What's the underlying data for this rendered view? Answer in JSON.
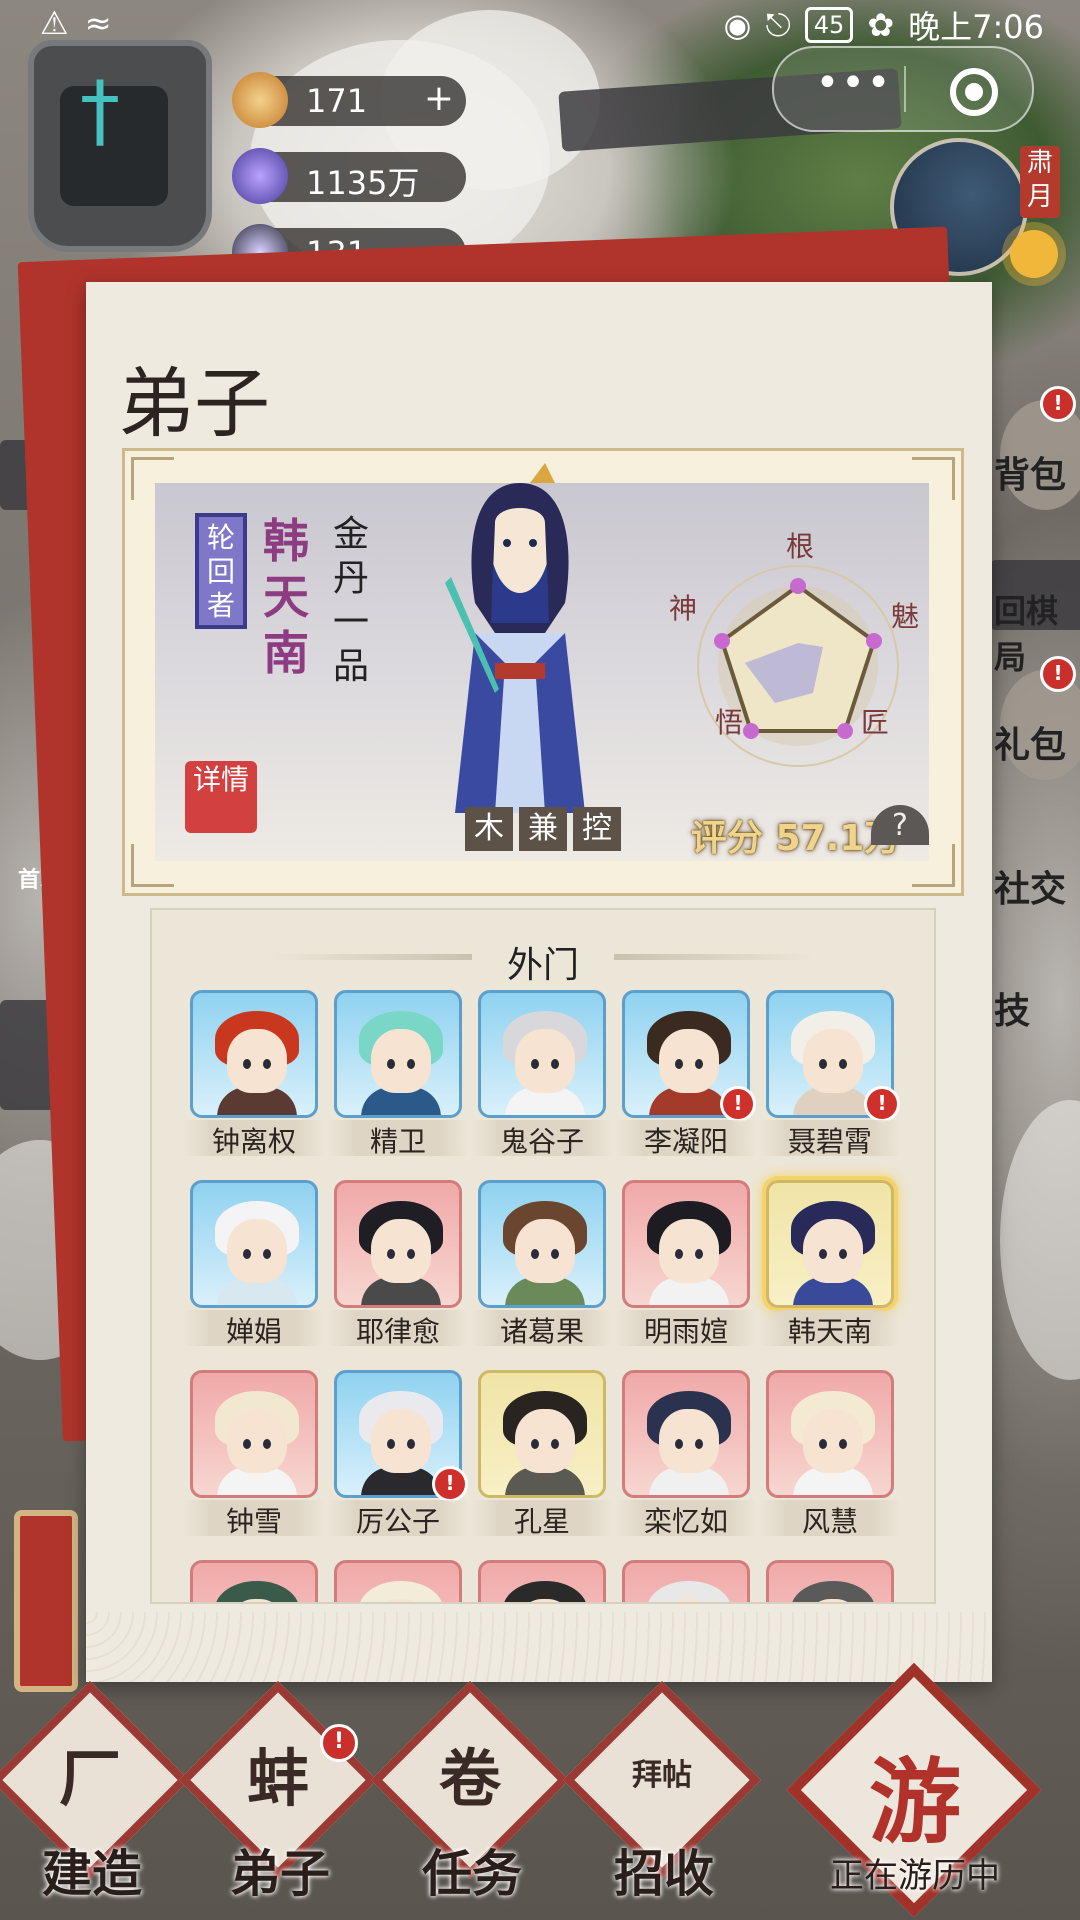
{
  "status_bar": {
    "time": "晚上7:06",
    "battery": "45"
  },
  "capsule": {
    "more": "•••"
  },
  "resources": [
    {
      "icon": "spirit-stone-icon",
      "value": "171",
      "plus": "+"
    },
    {
      "icon": "crystal-icon",
      "value": "1135万"
    },
    {
      "icon": "orb-icon",
      "value": "131"
    }
  ],
  "season": "肃月",
  "panel": {
    "title": "弟子",
    "character": {
      "tag": "轮回者",
      "name": "韩天南",
      "rank": "金丹一品",
      "detail": "详情",
      "traits": [
        "木",
        "兼",
        "控"
      ],
      "score": "评分 57.1万",
      "help": "?",
      "radar_labels": {
        "top": "根",
        "right": "魅",
        "bottom_right": "匠",
        "bottom_left": "悟",
        "left": "神"
      }
    },
    "roster": {
      "tab": "外门",
      "disciples": [
        {
          "name": "钟离权",
          "bg": "blue",
          "hair": "#c9371f",
          "cloth": "#5a3a32",
          "alert": false
        },
        {
          "name": "精卫",
          "bg": "blue",
          "hair": "#7ad6c6",
          "cloth": "#2b5a8a",
          "alert": false
        },
        {
          "name": "鬼谷子",
          "bg": "blue",
          "hair": "#d8d8dc",
          "cloth": "#f4f4f4",
          "alert": false
        },
        {
          "name": "李凝阳",
          "bg": "blue",
          "hair": "#3a2a20",
          "cloth": "#a33a2a",
          "alert": true
        },
        {
          "name": "聂碧霄",
          "bg": "blue",
          "hair": "#f2efe8",
          "cloth": "#e0d0c0",
          "alert": true
        },
        {
          "name": "婵娟",
          "bg": "blue",
          "hair": "#f4f4f6",
          "cloth": "#d7e8f0",
          "alert": false
        },
        {
          "name": "耶律愈",
          "bg": "red",
          "hair": "#1e1e24",
          "cloth": "#4a4a4a",
          "alert": false
        },
        {
          "name": "诸葛果",
          "bg": "blue",
          "hair": "#6a4630",
          "cloth": "#6a8a5a",
          "alert": false
        },
        {
          "name": "明雨媗",
          "bg": "red",
          "hair": "#1c1c22",
          "cloth": "#f2f2f2",
          "alert": false
        },
        {
          "name": "韩天南",
          "bg": "gold",
          "hair": "#2a2a5a",
          "cloth": "#3a4a9a",
          "alert": false,
          "selected": true
        },
        {
          "name": "钟雪",
          "bg": "red",
          "hair": "#f2e8d0",
          "cloth": "#f4f4f4",
          "alert": false
        },
        {
          "name": "厉公子",
          "bg": "blue",
          "hair": "#eaeaee",
          "cloth": "#2a2a2e",
          "alert": true
        },
        {
          "name": "孔星",
          "bg": "gold",
          "hair": "#2a2420",
          "cloth": "#5a5a52",
          "alert": false
        },
        {
          "name": "栾忆如",
          "bg": "red",
          "hair": "#2a3250",
          "cloth": "#f0f0f0",
          "alert": false
        },
        {
          "name": "风慧",
          "bg": "red",
          "hair": "#f4ead2",
          "cloth": "#f4f4f4",
          "alert": false
        },
        {
          "name": "",
          "bg": "red",
          "hair": "#3a5a4a",
          "cloth": "#f0f0f0",
          "alert": false
        },
        {
          "name": "",
          "bg": "red",
          "hair": "#f2ecd8",
          "cloth": "#f0f0f0",
          "alert": false
        },
        {
          "name": "",
          "bg": "red",
          "hair": "#2a2a2a",
          "cloth": "#f0f0f0",
          "alert": false
        },
        {
          "name": "",
          "bg": "red",
          "hair": "#e8e8e8",
          "cloth": "#f0f0f0",
          "alert": false
        },
        {
          "name": "",
          "bg": "red",
          "hair": "#5a5a5a",
          "cloth": "#f0f0f0",
          "alert": false
        }
      ]
    }
  },
  "side_menu": {
    "bag": "背包",
    "chess": "回棋局",
    "gift": "礼包",
    "social": "社交",
    "skill": "技",
    "first_recharge": "首次"
  },
  "bottom_nav": [
    {
      "glyph": "厂",
      "label": "建造",
      "alert": false
    },
    {
      "glyph": "蚌",
      "label": "弟子",
      "alert": true
    },
    {
      "glyph": "卷",
      "label": "任务",
      "alert": false
    },
    {
      "glyph": "拜帖",
      "label": "招收",
      "alert": false
    }
  ],
  "travel": {
    "glyph": "游",
    "label": "正在游历中"
  },
  "colors": {
    "accent_red": "#b0342c",
    "panel_bg": "#efeae0",
    "name_purple": "#8e3c82",
    "score_gold": "#f0d48a"
  }
}
